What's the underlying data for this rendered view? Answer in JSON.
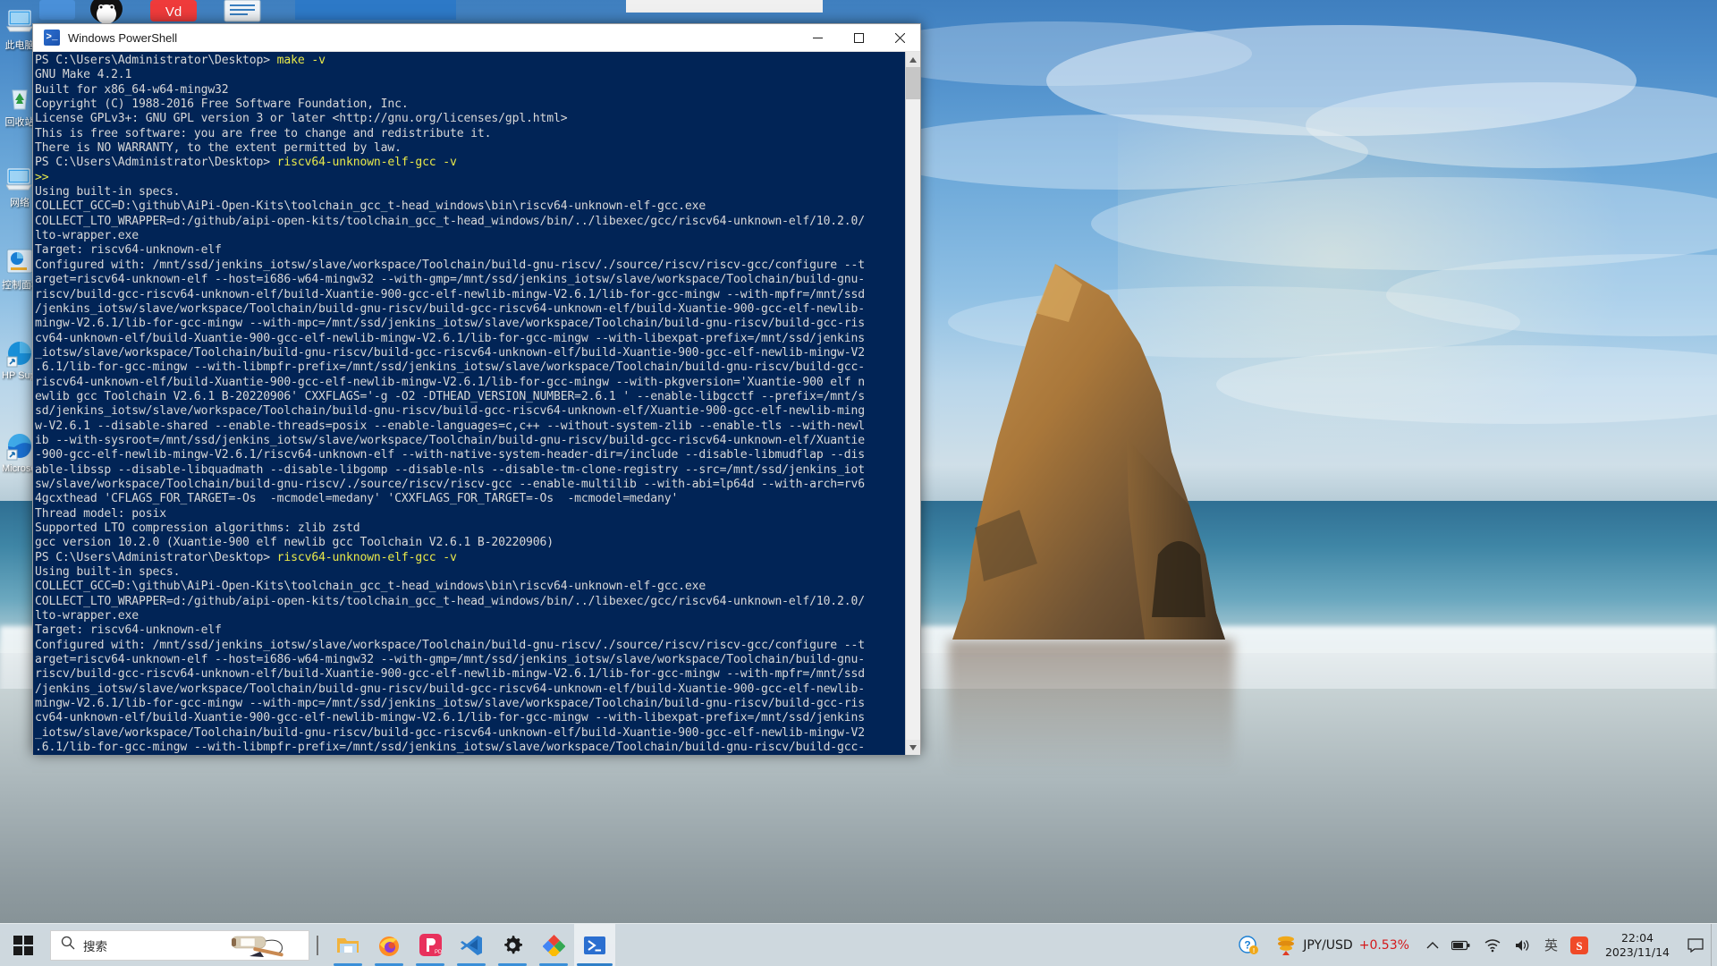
{
  "window": {
    "title": "Windows PowerShell",
    "icon": "powershell-icon",
    "minimize_label": "—",
    "maximize_label": "☐",
    "close_label": "✕"
  },
  "console": {
    "prompt_1": "PS C:\\Users\\Administrator\\Desktop> ",
    "cmd_1": "make -v",
    "prompt_2": "PS C:\\Users\\Administrator\\Desktop> ",
    "cmd_2": "riscv64-unknown-elf-gcc -v",
    "prompt_3": "PS C:\\Users\\Administrator\\Desktop> ",
    "cmd_3": "riscv64-unknown-elf-gcc -v",
    "continuation": ">>",
    "block_make": "GNU Make 4.2.1\nBuilt for x86_64-w64-mingw32\nCopyright (C) 1988-2016 Free Software Foundation, Inc.\nLicense GPLv3+: GNU GPL version 3 or later <http://gnu.org/licenses/gpl.html>\nThis is free software: you are free to change and redistribute it.\nThere is NO WARRANTY, to the extent permitted by law.",
    "block_gcc_1": "Using built-in specs.\nCOLLECT_GCC=D:\\github\\AiPi-Open-Kits\\toolchain_gcc_t-head_windows\\bin\\riscv64-unknown-elf-gcc.exe\nCOLLECT_LTO_WRAPPER=d:/github/aipi-open-kits/toolchain_gcc_t-head_windows/bin/../libexec/gcc/riscv64-unknown-elf/10.2.0/\nlto-wrapper.exe\nTarget: riscv64-unknown-elf\nConfigured with: /mnt/ssd/jenkins_iotsw/slave/workspace/Toolchain/build-gnu-riscv/./source/riscv/riscv-gcc/configure --t\narget=riscv64-unknown-elf --host=i686-w64-mingw32 --with-gmp=/mnt/ssd/jenkins_iotsw/slave/workspace/Toolchain/build-gnu-\nriscv/build-gcc-riscv64-unknown-elf/build-Xuantie-900-gcc-elf-newlib-mingw-V2.6.1/lib-for-gcc-mingw --with-mpfr=/mnt/ssd\n/jenkins_iotsw/slave/workspace/Toolchain/build-gnu-riscv/build-gcc-riscv64-unknown-elf/build-Xuantie-900-gcc-elf-newlib-\nmingw-V2.6.1/lib-for-gcc-mingw --with-mpc=/mnt/ssd/jenkins_iotsw/slave/workspace/Toolchain/build-gnu-riscv/build-gcc-ris\ncv64-unknown-elf/build-Xuantie-900-gcc-elf-newlib-mingw-V2.6.1/lib-for-gcc-mingw --with-libexpat-prefix=/mnt/ssd/jenkins\n_iotsw/slave/workspace/Toolchain/build-gnu-riscv/build-gcc-riscv64-unknown-elf/build-Xuantie-900-gcc-elf-newlib-mingw-V2\n.6.1/lib-for-gcc-mingw --with-libmpfr-prefix=/mnt/ssd/jenkins_iotsw/slave/workspace/Toolchain/build-gnu-riscv/build-gcc-\nriscv64-unknown-elf/build-Xuantie-900-gcc-elf-newlib-mingw-V2.6.1/lib-for-gcc-mingw --with-pkgversion='Xuantie-900 elf n\newlib gcc Toolchain V2.6.1 B-20220906' CXXFLAGS='-g -O2 -DTHEAD_VERSION_NUMBER=2.6.1 ' --enable-libgcctf --prefix=/mnt/s\nsd/jenkins_iotsw/slave/workspace/Toolchain/build-gnu-riscv/build-gcc-riscv64-unknown-elf/Xuantie-900-gcc-elf-newlib-ming\nw-V2.6.1 --disable-shared --enable-threads=posix --enable-languages=c,c++ --without-system-zlib --enable-tls --with-newl\nib --with-sysroot=/mnt/ssd/jenkins_iotsw/slave/workspace/Toolchain/build-gnu-riscv/build-gcc-riscv64-unknown-elf/Xuantie\n-900-gcc-elf-newlib-mingw-V2.6.1/riscv64-unknown-elf --with-native-system-header-dir=/include --disable-libmudflap --dis\nable-libssp --disable-libquadmath --disable-libgomp --disable-nls --disable-tm-clone-registry --src=/mnt/ssd/jenkins_iot\nsw/slave/workspace/Toolchain/build-gnu-riscv/./source/riscv/riscv-gcc --enable-multilib --with-abi=lp64d --with-arch=rv6\n4gcxthead 'CFLAGS_FOR_TARGET=-Os  -mcmodel=medany' 'CXXFLAGS_FOR_TARGET=-Os  -mcmodel=medany'\nThread model: posix\nSupported LTO compression algorithms: zlib zstd\ngcc version 10.2.0 (Xuantie-900 elf newlib gcc Toolchain V2.6.1 B-20220906)",
    "block_gcc_2": "Using built-in specs.\nCOLLECT_GCC=D:\\github\\AiPi-Open-Kits\\toolchain_gcc_t-head_windows\\bin\\riscv64-unknown-elf-gcc.exe\nCOLLECT_LTO_WRAPPER=d:/github/aipi-open-kits/toolchain_gcc_t-head_windows/bin/../libexec/gcc/riscv64-unknown-elf/10.2.0/\nlto-wrapper.exe\nTarget: riscv64-unknown-elf\nConfigured with: /mnt/ssd/jenkins_iotsw/slave/workspace/Toolchain/build-gnu-riscv/./source/riscv/riscv-gcc/configure --t\narget=riscv64-unknown-elf --host=i686-w64-mingw32 --with-gmp=/mnt/ssd/jenkins_iotsw/slave/workspace/Toolchain/build-gnu-\nriscv/build-gcc-riscv64-unknown-elf/build-Xuantie-900-gcc-elf-newlib-mingw-V2.6.1/lib-for-gcc-mingw --with-mpfr=/mnt/ssd\n/jenkins_iotsw/slave/workspace/Toolchain/build-gnu-riscv/build-gcc-riscv64-unknown-elf/build-Xuantie-900-gcc-elf-newlib-\nmingw-V2.6.1/lib-for-gcc-mingw --with-mpc=/mnt/ssd/jenkins_iotsw/slave/workspace/Toolchain/build-gnu-riscv/build-gcc-ris\ncv64-unknown-elf/build-Xuantie-900-gcc-elf-newlib-mingw-V2.6.1/lib-for-gcc-mingw --with-libexpat-prefix=/mnt/ssd/jenkins\n_iotsw/slave/workspace/Toolchain/build-gnu-riscv/build-gcc-riscv64-unknown-elf/build-Xuantie-900-gcc-elf-newlib-mingw-V2\n.6.1/lib-for-gcc-mingw --with-libmpfr-prefix=/mnt/ssd/jenkins_iotsw/slave/workspace/Toolchain/build-gnu-riscv/build-gcc-"
  },
  "desktop_icons": [
    {
      "label": "此电脑",
      "icon": "this-pc-icon",
      "glyph": "🖥"
    },
    {
      "label": "回收站",
      "icon": "recycle-bin-icon",
      "glyph": "♻"
    },
    {
      "label": "网络",
      "icon": "network-icon",
      "glyph": "🖥"
    },
    {
      "label": "控制面板",
      "icon": "control-panel-icon",
      "glyph": "◔"
    },
    {
      "label": "HP Support Assistant",
      "icon": "hp-support-icon",
      "glyph": "◕"
    },
    {
      "label": "Microsoft Edge",
      "icon": "edge-icon",
      "glyph": "◔"
    }
  ],
  "taskbar": {
    "start": {
      "name": "start-button",
      "icon": "windows-logo-icon"
    },
    "search": {
      "placeholder": "搜索",
      "icon": "search-icon",
      "illustration": "calligraphy-brush-image"
    },
    "apps": [
      {
        "name": "file-explorer",
        "icon": "folder-icon",
        "active": false,
        "running": true
      },
      {
        "name": "firefox",
        "icon": "firefox-icon",
        "active": false,
        "running": true
      },
      {
        "name": "pdf-reader",
        "icon": "pdf-icon",
        "active": false,
        "running": true
      },
      {
        "name": "vs-code",
        "icon": "vscode-icon",
        "active": false,
        "running": true
      },
      {
        "name": "settings",
        "icon": "gear-icon",
        "active": false,
        "running": true
      },
      {
        "name": "drive",
        "icon": "drive-icon",
        "active": false,
        "running": true
      },
      {
        "name": "powershell",
        "icon": "powershell-icon",
        "active": true,
        "running": true
      }
    ],
    "tray": {
      "help": {
        "name": "help-icon",
        "glyph": "?"
      },
      "stock": {
        "icon": "stock-coins-icon",
        "label": "JPY/USD",
        "change": "+0.53%",
        "change_color": "#d4191b"
      },
      "chevron": {
        "name": "show-hidden-icons",
        "glyph": "∧"
      },
      "battery": {
        "name": "battery-icon"
      },
      "wifi": {
        "name": "wifi-icon"
      },
      "volume": {
        "name": "volume-icon"
      },
      "ime": {
        "name": "ime-indicator",
        "label": "英"
      },
      "sogou": {
        "name": "sogou-input-icon",
        "label": "S"
      },
      "clock": {
        "time": "22:04",
        "date": "2023/11/14"
      },
      "notifications": {
        "name": "action-center-icon"
      }
    }
  },
  "colors": {
    "console_bg": "#012456",
    "console_fg": "#d8d8d8",
    "console_cmd": "#e8e84a",
    "taskbar_bg": "#d4dee4",
    "accent": "#2f7fc8",
    "stock_red": "#d4191b"
  }
}
